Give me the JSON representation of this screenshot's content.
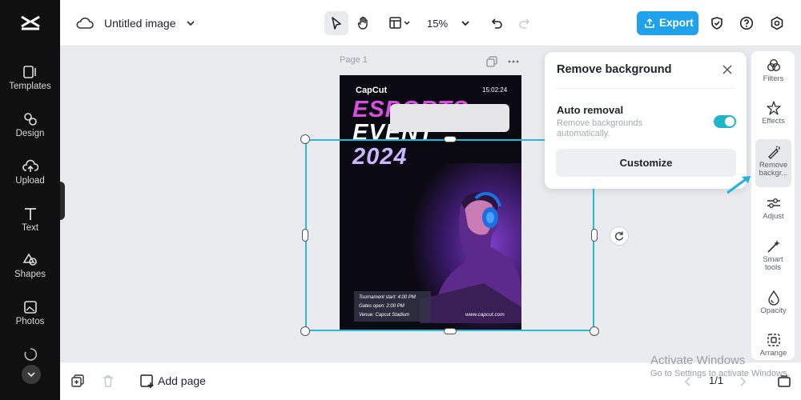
{
  "app": {
    "logo": "capcut-logo"
  },
  "rail": {
    "items": [
      {
        "label": "Templates",
        "icon": "templates-icon"
      },
      {
        "label": "Design",
        "icon": "design-icon"
      },
      {
        "label": "Upload",
        "icon": "upload-icon"
      },
      {
        "label": "Text",
        "icon": "text-icon"
      },
      {
        "label": "Shapes",
        "icon": "shapes-icon"
      },
      {
        "label": "Photos",
        "icon": "photos-icon"
      }
    ]
  },
  "header": {
    "title": "Untitled image",
    "zoom": "15%",
    "export_label": "Export"
  },
  "canvas": {
    "page_label": "Page 1",
    "poster": {
      "brand": "CapCut",
      "time": "15:02:24",
      "headline_1": "ESPORTS",
      "headline_2": "EVENT",
      "headline_3": "2024",
      "info_1": "Tournament start: 4:00 PM",
      "info_2": "Gates open: 2:00 PM",
      "info_3": "Venue: Capcut Stadium",
      "url": "www.capcut.com"
    }
  },
  "popover": {
    "title": "Remove background",
    "auto_removal_label": "Auto removal",
    "auto_removal_desc": "Remove backgrounds automatically.",
    "auto_removal_on": true,
    "customize_label": "Customize"
  },
  "right_panel": {
    "items": [
      {
        "label": "Filters",
        "icon": "filters-icon"
      },
      {
        "label": "Effects",
        "icon": "effects-icon"
      },
      {
        "label": "Remove backgr...",
        "icon": "remove-background-icon",
        "active": true
      },
      {
        "label": "Adjust",
        "icon": "adjust-icon"
      },
      {
        "label": "Smart tools",
        "icon": "smart-tools-icon"
      },
      {
        "label": "Opacity",
        "icon": "opacity-icon"
      },
      {
        "label": "Arrange",
        "icon": "arrange-icon"
      }
    ]
  },
  "footer": {
    "add_page_label": "Add page",
    "page_counter": "1/1"
  },
  "watermark": {
    "line1": "Activate Windows",
    "line2": "Go to Settings to activate Windows."
  },
  "colors": {
    "accent": "#1fa1ec",
    "selection": "#2bb7d6",
    "toggle": "#1fb5c6",
    "rail": "#101010"
  }
}
